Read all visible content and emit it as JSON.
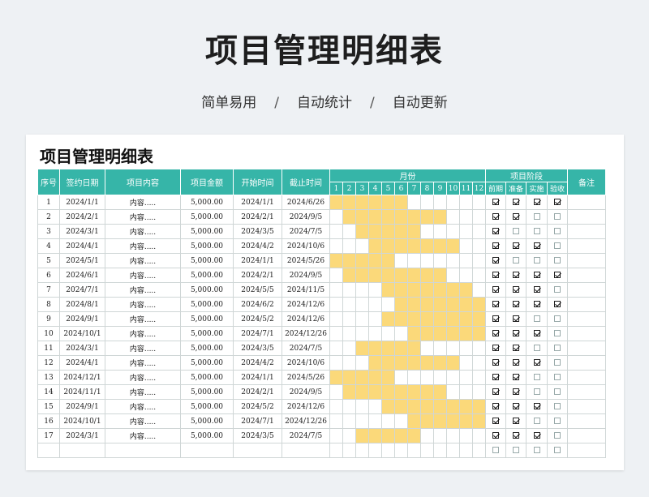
{
  "hero": {
    "title": "项目管理明细表",
    "tag1": "简单易用",
    "tag2": "自动统计",
    "tag3": "自动更新",
    "separator": "/"
  },
  "sheet": {
    "title": "项目管理明细表",
    "columns": {
      "seq": "序号",
      "sign_date": "签约日期",
      "content": "项目内容",
      "amount": "项目金额",
      "start": "开始时间",
      "end": "截止时间",
      "month_group": "月份",
      "months": [
        "1",
        "2",
        "3",
        "4",
        "5",
        "6",
        "7",
        "8",
        "9",
        "10",
        "11",
        "12"
      ],
      "stage_group": "项目阶段",
      "stages": [
        "前期",
        "准备",
        "实施",
        "验收"
      ],
      "remark": "备注"
    },
    "colors": {
      "header": "#36b5a8",
      "gantt": "#fbd97a"
    },
    "rows": [
      {
        "seq": "1",
        "sign": "2024/1/1",
        "content": "内容.....",
        "amount": "5,000.00",
        "start": "2024/1/1",
        "end": "2024/6/26",
        "active": [
          1,
          6
        ],
        "stages": [
          true,
          true,
          true,
          true
        ]
      },
      {
        "seq": "2",
        "sign": "2024/2/1",
        "content": "内容.....",
        "amount": "5,000.00",
        "start": "2024/2/1",
        "end": "2024/9/5",
        "active": [
          2,
          9
        ],
        "stages": [
          true,
          true,
          false,
          false
        ]
      },
      {
        "seq": "3",
        "sign": "2024/3/1",
        "content": "内容.....",
        "amount": "5,000.00",
        "start": "2024/3/5",
        "end": "2024/7/5",
        "active": [
          3,
          7
        ],
        "stages": [
          true,
          false,
          false,
          false
        ]
      },
      {
        "seq": "4",
        "sign": "2024/4/1",
        "content": "内容.....",
        "amount": "5,000.00",
        "start": "2024/4/2",
        "end": "2024/10/6",
        "active": [
          4,
          10
        ],
        "stages": [
          true,
          true,
          true,
          false
        ]
      },
      {
        "seq": "5",
        "sign": "2024/5/1",
        "content": "内容.....",
        "amount": "5,000.00",
        "start": "2024/1/1",
        "end": "2024/5/26",
        "active": [
          1,
          5
        ],
        "stages": [
          true,
          false,
          false,
          false
        ]
      },
      {
        "seq": "6",
        "sign": "2024/6/1",
        "content": "内容.....",
        "amount": "5,000.00",
        "start": "2024/2/1",
        "end": "2024/9/5",
        "active": [
          2,
          9
        ],
        "stages": [
          true,
          true,
          true,
          true
        ]
      },
      {
        "seq": "7",
        "sign": "2024/7/1",
        "content": "内容.....",
        "amount": "5,000.00",
        "start": "2024/5/5",
        "end": "2024/11/5",
        "active": [
          5,
          11
        ],
        "stages": [
          true,
          true,
          true,
          false
        ]
      },
      {
        "seq": "8",
        "sign": "2024/8/1",
        "content": "内容.....",
        "amount": "5,000.00",
        "start": "2024/6/2",
        "end": "2024/12/6",
        "active": [
          6,
          12
        ],
        "stages": [
          true,
          true,
          true,
          true
        ]
      },
      {
        "seq": "9",
        "sign": "2024/9/1",
        "content": "内容.....",
        "amount": "5,000.00",
        "start": "2024/5/2",
        "end": "2024/12/6",
        "active": [
          5,
          12
        ],
        "stages": [
          true,
          true,
          false,
          false
        ]
      },
      {
        "seq": "10",
        "sign": "2024/10/1",
        "content": "内容.....",
        "amount": "5,000.00",
        "start": "2024/7/1",
        "end": "2024/12/26",
        "active": [
          7,
          12
        ],
        "stages": [
          true,
          true,
          true,
          false
        ]
      },
      {
        "seq": "11",
        "sign": "2024/3/1",
        "content": "内容.....",
        "amount": "5,000.00",
        "start": "2024/3/5",
        "end": "2024/7/5",
        "active": [
          3,
          7
        ],
        "stages": [
          true,
          true,
          false,
          false
        ]
      },
      {
        "seq": "12",
        "sign": "2024/4/1",
        "content": "内容.....",
        "amount": "5,000.00",
        "start": "2024/4/2",
        "end": "2024/10/6",
        "active": [
          4,
          10
        ],
        "stages": [
          true,
          true,
          true,
          false
        ]
      },
      {
        "seq": "13",
        "sign": "2024/12/1",
        "content": "内容.....",
        "amount": "5,000.00",
        "start": "2024/1/1",
        "end": "2024/5/26",
        "active": [
          1,
          5
        ],
        "stages": [
          true,
          true,
          false,
          false
        ]
      },
      {
        "seq": "14",
        "sign": "2024/11/1",
        "content": "内容.....",
        "amount": "5,000.00",
        "start": "2024/2/1",
        "end": "2024/9/5",
        "active": [
          2,
          9
        ],
        "stages": [
          true,
          true,
          false,
          false
        ]
      },
      {
        "seq": "15",
        "sign": "2024/9/1",
        "content": "内容.....",
        "amount": "5,000.00",
        "start": "2024/5/2",
        "end": "2024/12/6",
        "active": [
          5,
          12
        ],
        "stages": [
          true,
          true,
          true,
          false
        ]
      },
      {
        "seq": "16",
        "sign": "2024/10/1",
        "content": "内容.....",
        "amount": "5,000.00",
        "start": "2024/7/1",
        "end": "2024/12/26",
        "active": [
          7,
          12
        ],
        "stages": [
          true,
          true,
          false,
          false
        ]
      },
      {
        "seq": "17",
        "sign": "2024/3/1",
        "content": "内容.....",
        "amount": "5,000.00",
        "start": "2024/3/5",
        "end": "2024/7/5",
        "active": [
          3,
          7
        ],
        "stages": [
          true,
          true,
          true,
          false
        ]
      },
      {
        "seq": "",
        "sign": "",
        "content": "",
        "amount": "",
        "start": "",
        "end": "",
        "active": null,
        "stages": [
          false,
          false,
          false,
          false
        ]
      }
    ]
  }
}
